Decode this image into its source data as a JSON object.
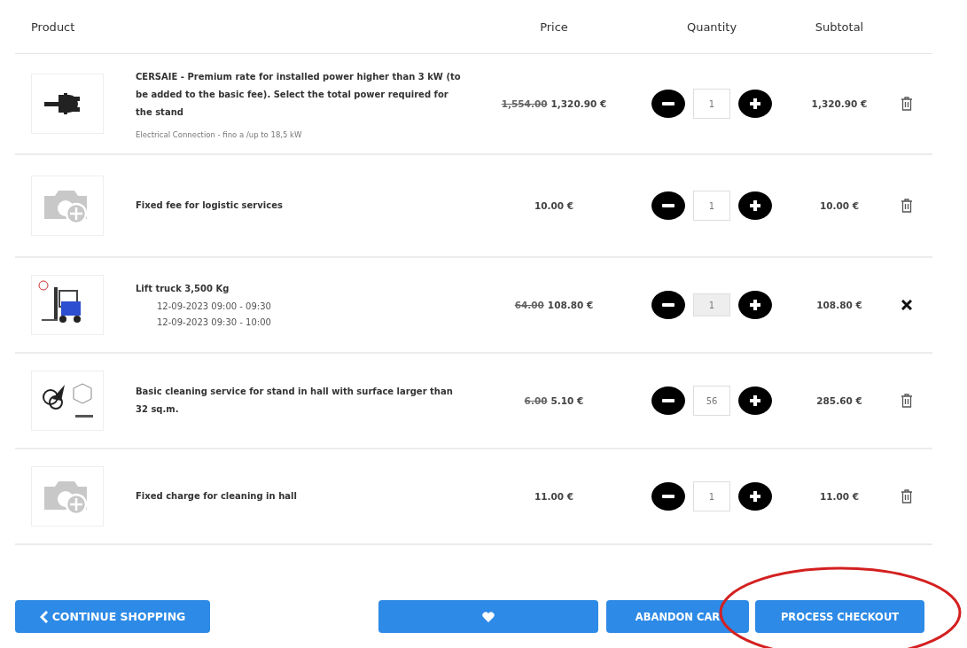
{
  "columns": [
    "Product",
    "Price",
    "Quantity",
    "Subtotal"
  ],
  "rows": [
    {
      "kind": "item",
      "name": "CERSAIE - Premium rate for installed power higher than 3 kW (to be added to the basic fee). Select the total power required for the stand",
      "details": [
        "Electrical Connection - fino a /up to 18,5 kW"
      ],
      "old_price": "1,554.00",
      "price": "1,320.90 €",
      "quantity": "1",
      "quantity_disabled": false,
      "subtotal": "1,320.90 €"
    },
    {
      "kind": "item",
      "name": "Fixed fee for logistic services",
      "details": [],
      "price": "10.00 €",
      "quantity": "1",
      "quantity_disabled": false,
      "subtotal": "10.00 €"
    },
    {
      "kind": "booking",
      "name": "Lift truck 3,500 Kg",
      "details": [
        "12-09-2023 09:00 - 09:30",
        "12-09-2023 09:30 - 10:00"
      ],
      "old_price": "64.00",
      "price": "108.80 €",
      "quantity": "1",
      "quantity_disabled": true,
      "subtotal": "108.80 €"
    },
    {
      "kind": "item",
      "name": "Basic cleaning service for stand in hall with surface larger than 32 sq.m.",
      "details": [],
      "old_price": "6.00",
      "price": "5.10 €",
      "quantity": "56",
      "quantity_disabled": false,
      "subtotal": "285.60 €"
    },
    {
      "kind": "item",
      "name": "Fixed charge for cleaning in hall",
      "details": [],
      "price": "11.00 €",
      "quantity": "1",
      "quantity_disabled": false,
      "subtotal": "11.00 €"
    }
  ],
  "buttons": [
    {
      "kind": "back",
      "label": "CONTINUE SHOPPING"
    },
    {
      "kind": "wishlist"
    },
    {
      "kind": "plain",
      "label": "ABANDON CAR"
    },
    {
      "kind": "plain",
      "label": "PROCESS CHECKOUT",
      "circled": true
    }
  ]
}
